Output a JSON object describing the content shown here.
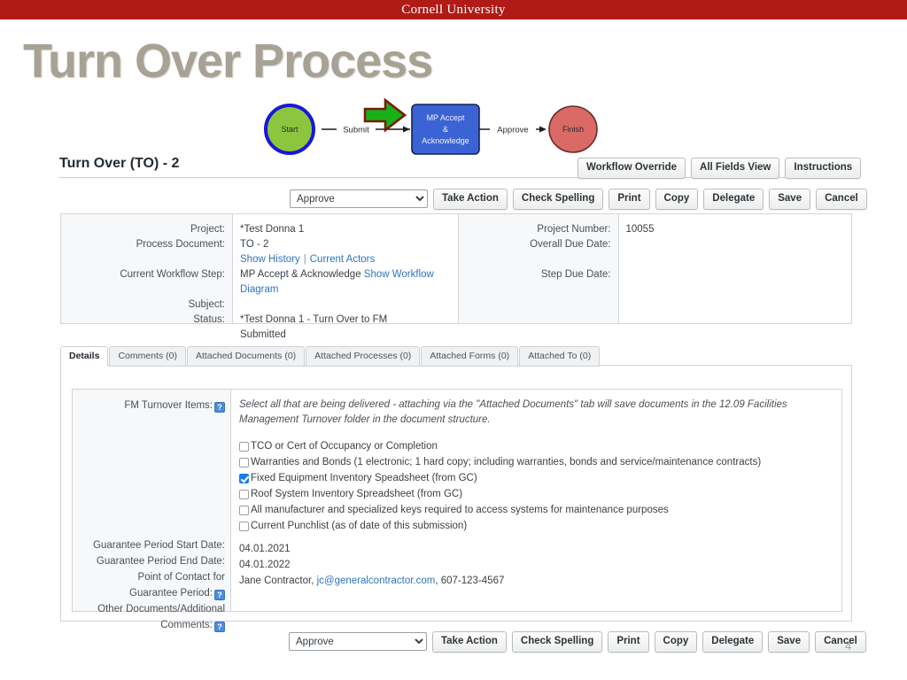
{
  "banner": {
    "wordmark": "Cornell University",
    "color": "#b01b17"
  },
  "slide": {
    "title": "Turn Over Process",
    "title_color": "#a8a294",
    "page_number": "4"
  },
  "workflow": {
    "start_label": "Start",
    "submit_label": "Submit",
    "node_label_line1": "MP Accept",
    "node_label_line2": "&",
    "node_label_line3": "Acknowledge",
    "approve_label": "Approve",
    "finish_label": "Finish",
    "colors": {
      "start_fill": "#8cc63f",
      "start_stroke": "#1818d8",
      "node_fill": "#3b63d4",
      "node_stroke": "#17205a",
      "finish_fill": "#d96a66",
      "finish_stroke": "#6b2b28",
      "arrow_fill": "#18b018",
      "arrow_stroke": "#7a1a0d"
    }
  },
  "document": {
    "heading": "Turn Over (TO) - 2",
    "top_buttons": [
      "Workflow Override",
      "All Fields View",
      "Instructions"
    ],
    "action_select_value": "Approve",
    "action_buttons": [
      "Take Action",
      "Check Spelling",
      "Print",
      "Copy",
      "Delegate",
      "Save",
      "Cancel"
    ]
  },
  "info": {
    "left": {
      "labels": [
        "Project:",
        "Process Document:",
        "",
        "Current Workflow Step:",
        "",
        "Subject:",
        "Status:"
      ],
      "project_label": "Project:",
      "project_value": "*Test Donna 1",
      "process_document_label": "Process Document:",
      "process_document_value": "TO - 2",
      "show_history_link": "Show History",
      "current_actors_link": "Current Actors",
      "link_separator": "|",
      "current_workflow_step_label": "Current Workflow Step:",
      "current_workflow_step_value": "MP Accept & Acknowledge",
      "show_workflow_diagram_link": "Show Workflow Diagram",
      "subject_label": "Subject:",
      "subject_value": "*Test Donna 1 - Turn Over to FM",
      "status_label": "Status:",
      "status_value": "Submitted"
    },
    "right": {
      "project_number_label": "Project Number:",
      "project_number_value": "10055",
      "overall_due_date_label": "Overall Due Date:",
      "overall_due_date_value": "",
      "step_due_date_label": "Step Due Date:",
      "step_due_date_value": ""
    }
  },
  "tabs": [
    {
      "label": "Details",
      "active": true
    },
    {
      "label": "Comments (0)",
      "active": false
    },
    {
      "label": "Attached Documents (0)",
      "active": false
    },
    {
      "label": "Attached Processes (0)",
      "active": false
    },
    {
      "label": "Attached Forms (0)",
      "active": false
    },
    {
      "label": "Attached To (0)",
      "active": false
    }
  ],
  "details": {
    "fm_turnover_items_label": "FM Turnover Items:",
    "help_glyph": "?",
    "instructions": "Select all that are being delivered - attaching via the \"Attached Documents\" tab will save documents in the 12.09 Facilities Management Turnover folder in the document structure.",
    "checkboxes": [
      {
        "label": "TCO or Cert of Occupancy or Completion",
        "checked": false
      },
      {
        "label": "Warranties and Bonds (1 electronic; 1 hard copy; including warranties, bonds and service/maintenance contracts)",
        "checked": false
      },
      {
        "label": "Fixed Equipment Inventory Speadsheet (from GC)",
        "checked": true
      },
      {
        "label": "Roof System Inventory Spreadsheet (from GC)",
        "checked": false
      },
      {
        "label": "All manufacturer and specialized keys required to access systems for maintenance purposes",
        "checked": false
      },
      {
        "label": "Current Punchlist (as of date of this submission)",
        "checked": false
      }
    ],
    "guarantee_start_label": "Guarantee Period Start Date:",
    "guarantee_start_value": "04.01.2021",
    "guarantee_end_label": "Guarantee Period End Date:",
    "guarantee_end_value": "04.01.2022",
    "point_of_contact_label_line1": "Point of Contact for",
    "point_of_contact_label_line2": "Guarantee Period:",
    "point_of_contact_name": "Jane Contractor,",
    "point_of_contact_email": "jc@generalcontractor.com",
    "point_of_contact_phone": ", 607-123-4567",
    "other_documents_label_line1": "Other Documents/Additional",
    "other_documents_label_line2": "Comments:"
  }
}
